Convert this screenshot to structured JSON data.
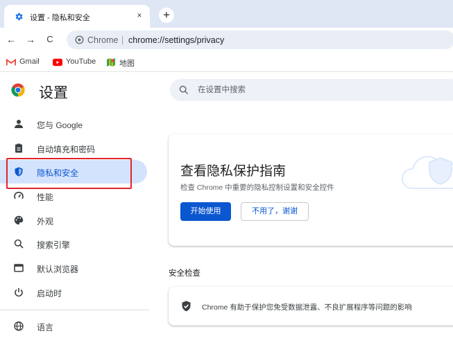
{
  "tab": {
    "title": "设置 - 隐私和安全",
    "close_label": "×"
  },
  "newtab_label": "+",
  "toolbar": {
    "back": "←",
    "forward": "→",
    "reload": "C"
  },
  "omnibox": {
    "site": "Chrome",
    "separator": "|",
    "url": "chrome://settings/privacy"
  },
  "bookmarks": [
    {
      "label": "Gmail",
      "icon": "gmail-icon"
    },
    {
      "label": "YouTube",
      "icon": "youtube-icon"
    },
    {
      "label": "地图",
      "icon": "maps-icon"
    }
  ],
  "header": {
    "title": "设置"
  },
  "search": {
    "placeholder": "在设置中搜索"
  },
  "sidebar": {
    "items": [
      {
        "label": "您与 Google",
        "icon": "person-icon"
      },
      {
        "label": "自动填充和密码",
        "icon": "clipboard-icon"
      },
      {
        "label": "隐私和安全",
        "icon": "shield-icon",
        "active": true
      },
      {
        "label": "性能",
        "icon": "speedometer-icon"
      },
      {
        "label": "外观",
        "icon": "palette-icon"
      },
      {
        "label": "搜索引擎",
        "icon": "search-icon"
      },
      {
        "label": "默认浏览器",
        "icon": "browser-icon"
      },
      {
        "label": "启动时",
        "icon": "power-icon"
      },
      {
        "label": "语言",
        "icon": "globe-icon"
      }
    ]
  },
  "guide": {
    "title": "查看隐私保护指南",
    "description": "检查 Chrome 中重要的隐私控制设置和安全控件",
    "primary_button": "开始使用",
    "secondary_button": "不用了，谢谢"
  },
  "safety": {
    "heading": "安全检查",
    "text": "Chrome 有助于保护您免受数据泄露、不良扩展程序等问题的影响"
  },
  "colors": {
    "accent": "#0b57d0",
    "active_bg": "#d3e3fd",
    "highlight": "#e0252b",
    "tabstrip": "#dfe6f4"
  }
}
